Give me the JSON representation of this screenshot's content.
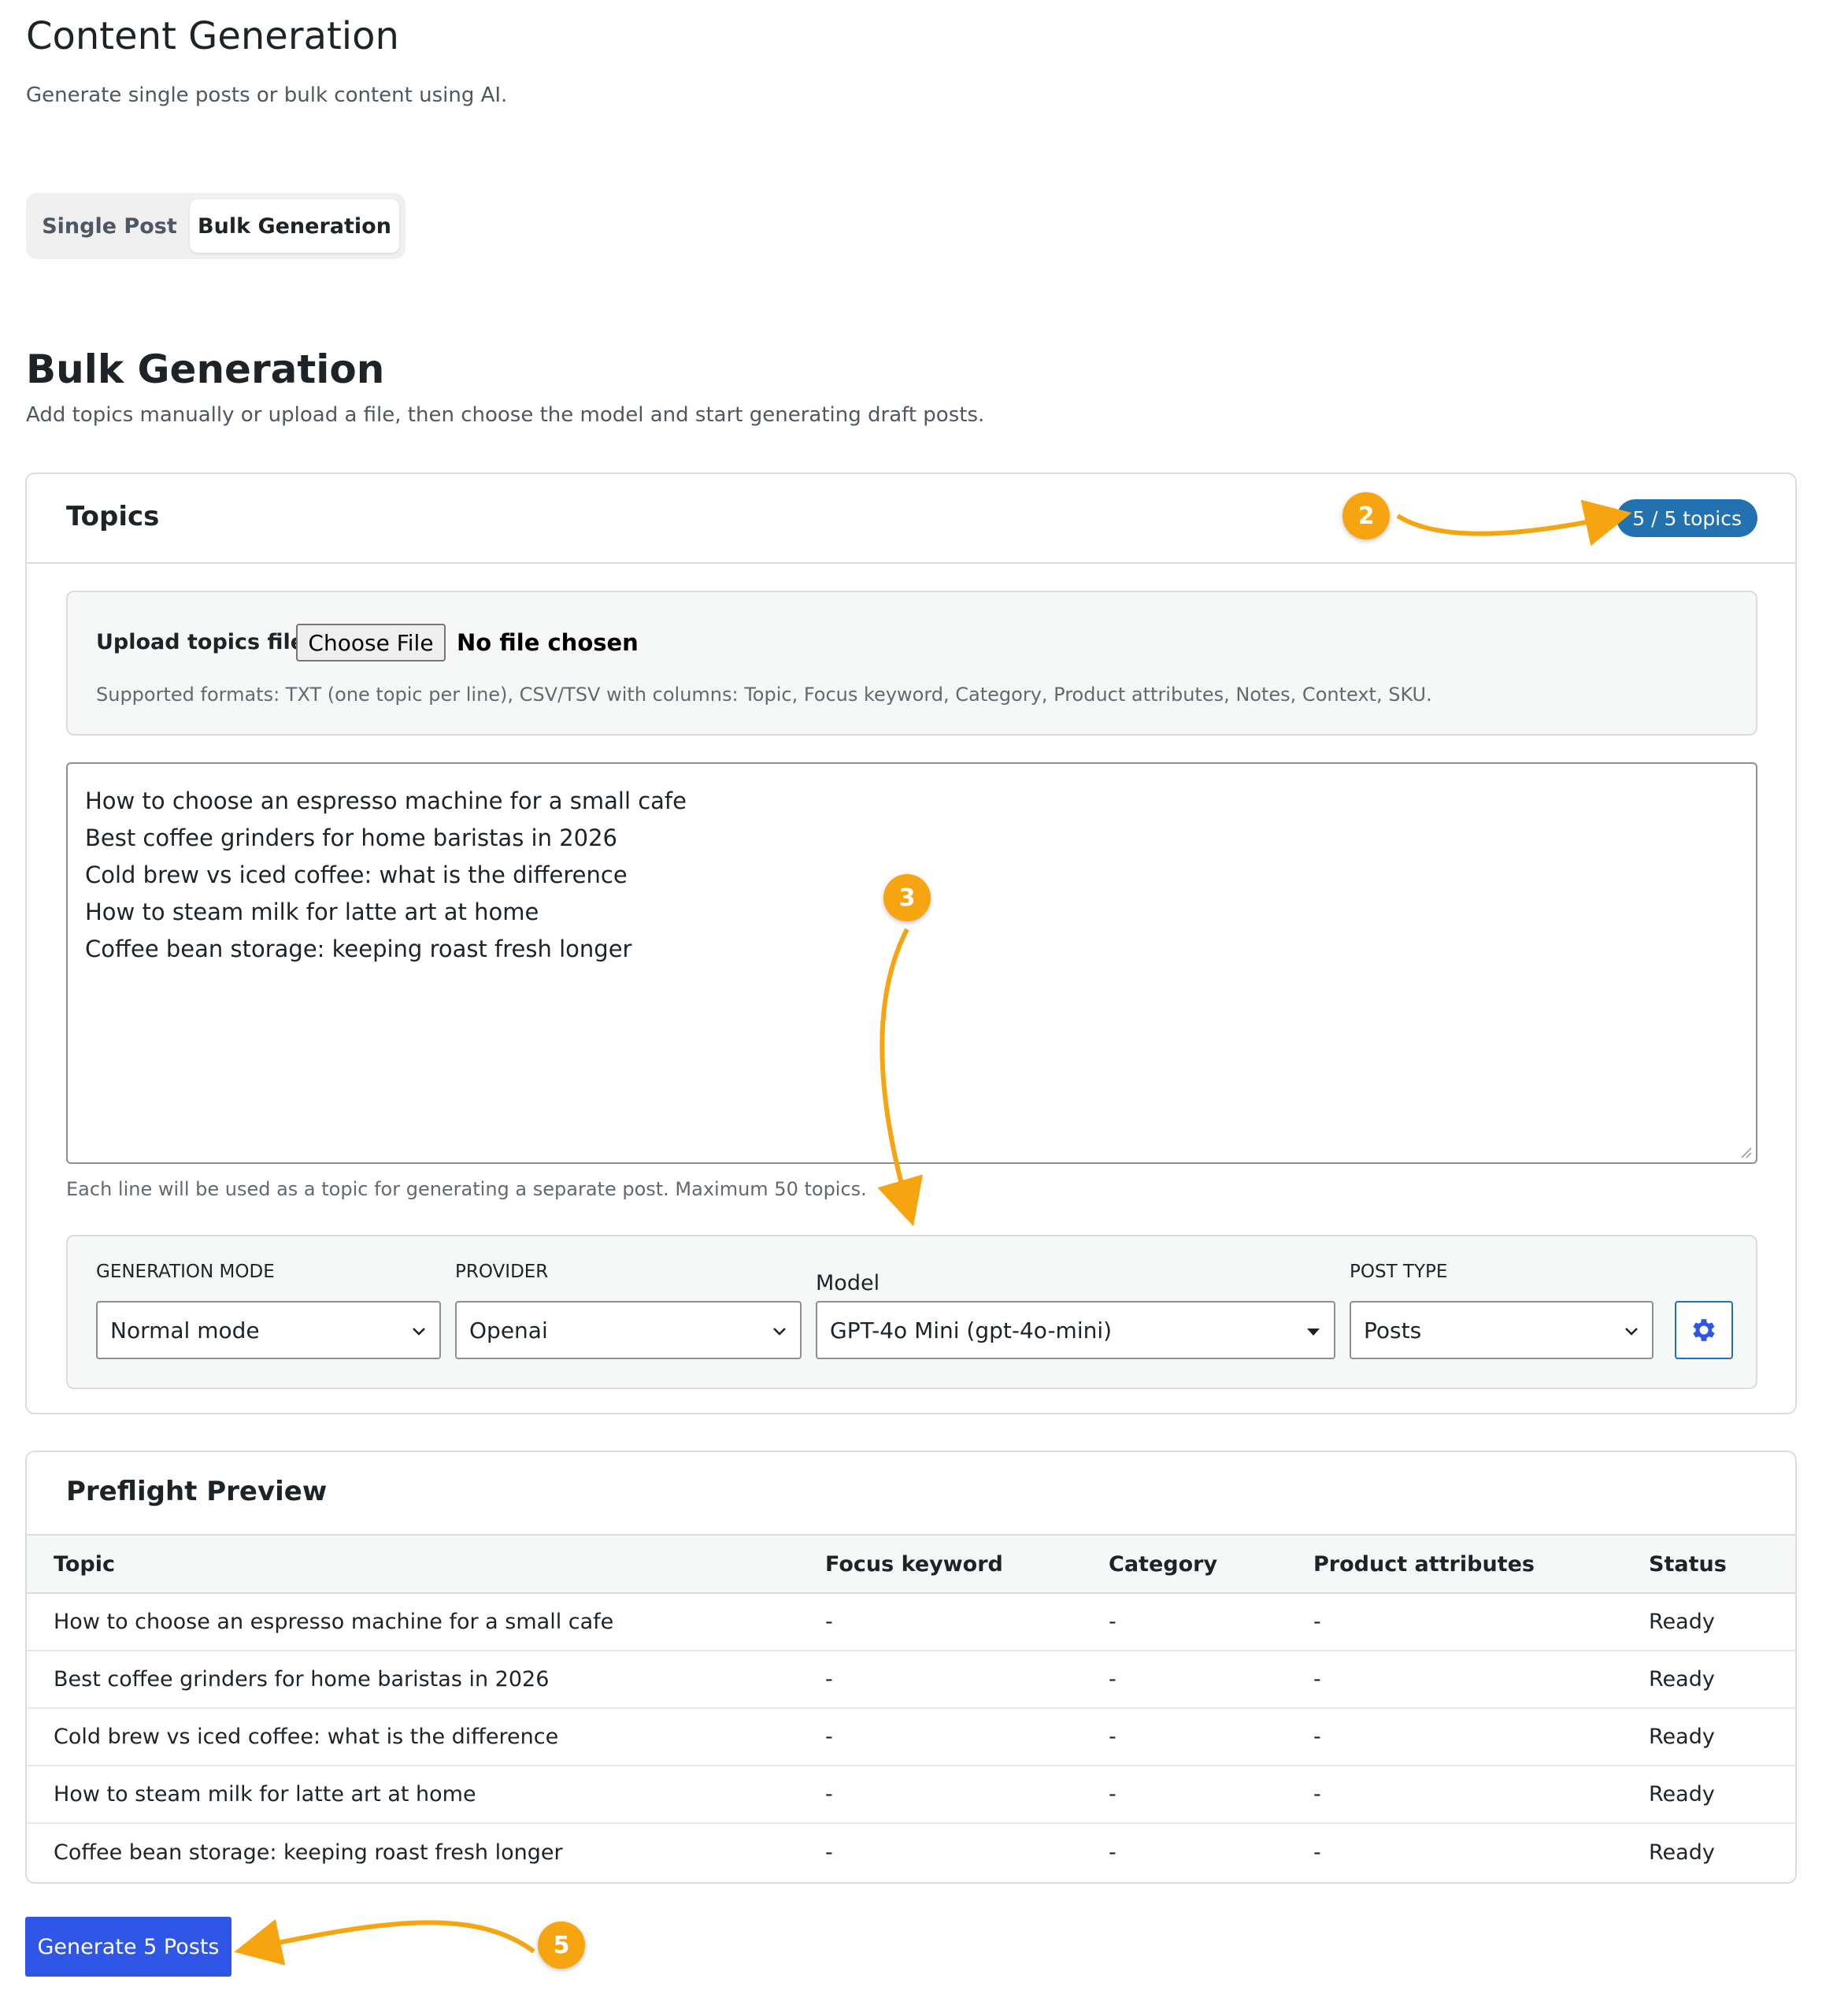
{
  "header": {
    "title": "Content Generation",
    "subtitle": "Generate single posts or bulk content using AI."
  },
  "tabs": [
    {
      "label": "Single Post",
      "active": false
    },
    {
      "label": "Bulk Generation",
      "active": true
    }
  ],
  "section": {
    "title": "Bulk Generation",
    "subtitle": "Add topics manually or upload a file, then choose the model and start generating draft posts."
  },
  "topics_card": {
    "title": "Topics",
    "count_badge": "5 / 5 topics",
    "upload": {
      "label": "Upload topics file",
      "button": "Choose File",
      "status": "No file chosen",
      "help": "Supported formats: TXT (one topic per line), CSV/TSV with columns: Topic, Focus keyword, Category, Product attributes, Notes, Context, SKU."
    },
    "topics": [
      "How to choose an espresso machine for a small cafe",
      "Best coffee grinders for home baristas in 2026",
      "Cold brew vs iced coffee: what is the difference",
      "How to steam milk for latte art at home",
      "Coffee bean storage: keeping roast fresh longer"
    ],
    "textarea_help": "Each line will be used as a topic for generating a separate post. Maximum 50 topics.",
    "settings": {
      "generation_mode_label": "GENERATION MODE",
      "generation_mode_value": "Normal mode",
      "provider_label": "PROVIDER",
      "provider_value": "Openai",
      "model_label": "Model",
      "model_value": "GPT-4o Mini (gpt-4o-mini)",
      "post_type_label": "POST TYPE",
      "post_type_value": "Posts"
    }
  },
  "preflight": {
    "title": "Preflight Preview",
    "columns": [
      "Topic",
      "Focus keyword",
      "Category",
      "Product attributes",
      "Status"
    ],
    "rows": [
      [
        "How to choose an espresso machine for a small cafe",
        "-",
        "-",
        "-",
        "Ready"
      ],
      [
        "Best coffee grinders for home baristas in 2026",
        "-",
        "-",
        "-",
        "Ready"
      ],
      [
        "Cold brew vs iced coffee: what is the difference",
        "-",
        "-",
        "-",
        "Ready"
      ],
      [
        "How to steam milk for latte art at home",
        "-",
        "-",
        "-",
        "Ready"
      ],
      [
        "Coffee bean storage: keeping roast fresh longer",
        "-",
        "-",
        "-",
        "Ready"
      ]
    ]
  },
  "generate_button": "Generate 5 Posts",
  "annotations": [
    "2",
    "3",
    "5"
  ],
  "colors": {
    "accent_blue": "#2271b1",
    "button_blue": "#2f56e6",
    "annotation_orange": "#f6a511"
  }
}
